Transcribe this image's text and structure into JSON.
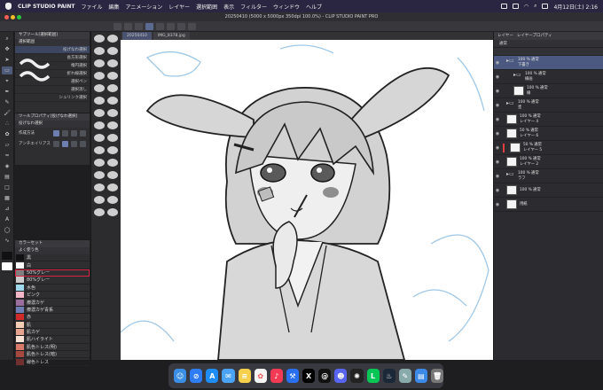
{
  "menubar": {
    "app_name": "CLIP STUDIO PAINT",
    "menus": [
      "ファイル",
      "編集",
      "アニメーション",
      "レイヤー",
      "選択範囲",
      "表示",
      "フィルター",
      "ウィンドウ",
      "ヘルプ"
    ],
    "clock": "4月12日(土) 2:16"
  },
  "window": {
    "title": "20250410 (5000 x 5000px 350dpi 100.0%) - CLIP STUDIO PAINT PRO"
  },
  "canvas_tabs": [
    "20250410",
    "IMG_8378.jpg"
  ],
  "sub_tool": {
    "header": "サブツール[選択範囲]",
    "tabs": "選択範囲",
    "items": [
      "投げなわ選択",
      "長方形選択",
      "楕円選択",
      "折れ線選択",
      "選択ペン",
      "選択消し",
      "シュリンク選択"
    ]
  },
  "tool_property": {
    "header": "ツールプロパティ[投げなわ選択]",
    "name": "投げなわ選択",
    "rows": [
      "作成方法",
      "アンチエイリアス"
    ]
  },
  "color_set": {
    "header": "カラーセット",
    "set_name": "よく使う色",
    "items": [
      {
        "label": "黒",
        "color": "#111111"
      },
      {
        "label": "白",
        "color": "#ffffff"
      },
      {
        "label": "50%グレー",
        "color": "#808080"
      },
      {
        "label": "80%グレー",
        "color": "#cccccc"
      },
      {
        "label": "水色",
        "color": "#9fd9ee"
      },
      {
        "label": "ピンク",
        "color": "#f3b7c8"
      },
      {
        "label": "療濃カゲ",
        "color": "#9a6fa0"
      },
      {
        "label": "療濃カゲ青系",
        "color": "#6f7fb5"
      },
      {
        "label": "赤",
        "color": "#d02a2a"
      },
      {
        "label": "肌",
        "color": "#f3cdb5"
      },
      {
        "label": "肌カゲ",
        "color": "#e6a48e"
      },
      {
        "label": "肌ハイライト",
        "color": "#fbe2d4"
      },
      {
        "label": "肌色トレス(明)",
        "color": "#d77a6a"
      },
      {
        "label": "肌色トレス(暗)",
        "color": "#a5483d"
      },
      {
        "label": "線色トレス",
        "color": "#703030"
      }
    ]
  },
  "layer_panel": {
    "header": "レイヤー",
    "header2": "レイヤープロパティ",
    "blend": "通常",
    "layers": [
      {
        "line1": "100 % 通常",
        "line2": "下書き",
        "type": "folder",
        "selected": true,
        "indent": false,
        "mark": false
      },
      {
        "line1": "100 % 通常",
        "line2": "線画",
        "type": "folder",
        "selected": false,
        "indent": true,
        "mark": false
      },
      {
        "line1": "100 % 通常",
        "line2": "線",
        "type": "layer",
        "selected": false,
        "indent": true,
        "mark": false
      },
      {
        "line1": "100 % 通常",
        "line2": "塗",
        "type": "folder",
        "selected": false,
        "indent": false,
        "mark": false
      },
      {
        "line1": "100 % 通常",
        "line2": "レイヤー 4",
        "type": "layer",
        "selected": false,
        "indent": false,
        "mark": false
      },
      {
        "line1": "50 % 通常",
        "line2": "レイヤー 6",
        "type": "layer",
        "selected": false,
        "indent": false,
        "mark": false
      },
      {
        "line1": "50 % 通常",
        "line2": "レイヤー 5",
        "type": "layer",
        "selected": false,
        "indent": false,
        "mark": true
      },
      {
        "line1": "100 % 通常",
        "line2": "レイヤー 2",
        "type": "layer",
        "selected": false,
        "indent": false,
        "mark": false
      },
      {
        "line1": "100 % 通常",
        "line2": "ラフ",
        "type": "folder",
        "selected": false,
        "indent": false,
        "mark": false
      },
      {
        "line1": "100 % 通常",
        "line2": "",
        "type": "layer",
        "selected": false,
        "indent": false,
        "mark": false
      },
      {
        "line1": "用紙",
        "line2": "",
        "type": "layer",
        "selected": false,
        "indent": false,
        "mark": false
      }
    ]
  },
  "zoom": "100.0",
  "dock_icons": [
    "finder",
    "safari",
    "app-store",
    "mail",
    "notes",
    "photos",
    "music",
    "xcode",
    "x",
    "threads",
    "discord",
    "chatgpt",
    "line",
    "steam",
    "clip-studio",
    "files",
    "trash"
  ]
}
